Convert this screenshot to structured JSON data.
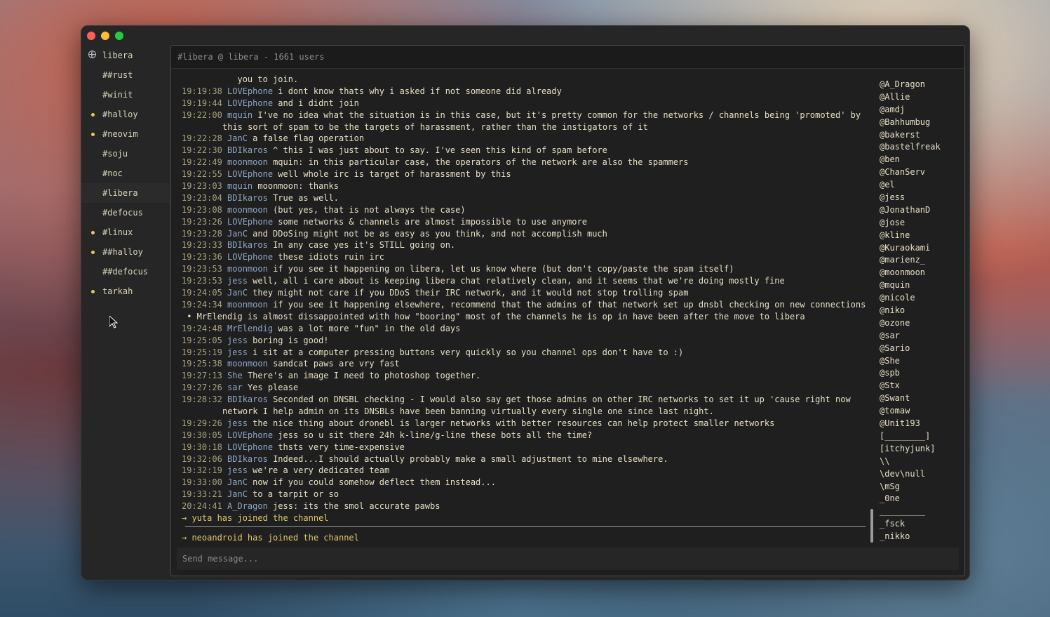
{
  "sidebar": {
    "server": "libera",
    "channels": [
      {
        "name": "##rust",
        "unread": false
      },
      {
        "name": "#winit",
        "unread": false
      },
      {
        "name": "#halloy",
        "unread": true
      },
      {
        "name": "#neovim",
        "unread": true
      },
      {
        "name": "#soju",
        "unread": false
      },
      {
        "name": "#noc",
        "unread": false
      },
      {
        "name": "#libera",
        "unread": false,
        "active": true
      },
      {
        "name": "#defocus",
        "unread": false
      },
      {
        "name": "#linux",
        "unread": true
      },
      {
        "name": "##halloy",
        "unread": true
      },
      {
        "name": "##defocus",
        "unread": false
      },
      {
        "name": "tarkah",
        "unread": true
      }
    ]
  },
  "header": {
    "title": "#libera @ libera - 1661 users"
  },
  "messages": [
    {
      "time": "",
      "nick": "",
      "text": "           you to join."
    },
    {
      "time": "19:19:38",
      "nick": "LOVEphone",
      "text": "i dont know thats why i asked if not someone did already"
    },
    {
      "time": "19:19:44",
      "nick": "LOVEphone",
      "text": "and i didnt join"
    },
    {
      "time": "19:22:00",
      "nick": "mquin",
      "text": "I've no idea what the situation is in this case, but it's pretty common for the networks / channels being 'promoted' by this sort of spam to be the targets of harassment, rather than the instigators of it",
      "tall": true
    },
    {
      "time": "19:22:28",
      "nick": "JanC",
      "text": "a false flag operation"
    },
    {
      "time": "19:22:30",
      "nick": "BDIkaros",
      "text": "^ this I was just about to say. I've seen this kind of spam before"
    },
    {
      "time": "19:22:49",
      "nick": "moonmoon",
      "text": "mquin: in this particular case, the operators of the network are also the spammers"
    },
    {
      "time": "19:22:55",
      "nick": "LOVEphone",
      "text": "well whole irc is target of harassment by this"
    },
    {
      "time": "19:23:03",
      "nick": "mquin",
      "text": "moonmoon: thanks"
    },
    {
      "time": "19:23:04",
      "nick": "BDIkaros",
      "text": "True as well."
    },
    {
      "time": "19:23:08",
      "nick": "moonmoon",
      "text": "(but yes, that is not always the case)"
    },
    {
      "time": "19:23:26",
      "nick": "LOVEphone",
      "text": "some networks & channels are almost impossible to use anymore"
    },
    {
      "time": "19:23:28",
      "nick": "JanC",
      "text": "and DDoSing might not be as easy as you think, and not accomplish much"
    },
    {
      "time": "19:23:33",
      "nick": "BDIkaros",
      "text": "In any case yes it's STILL going on."
    },
    {
      "time": "19:23:36",
      "nick": "LOVEphone",
      "text": "these idiots ruin irc"
    },
    {
      "time": "19:23:53",
      "nick": "moonmoon",
      "text": "if you see it happening on libera, let us know where (but don't copy/paste the spam itself)"
    },
    {
      "time": "19:23:53",
      "nick": "jess",
      "text": "well, all i care about is keeping libera chat relatively clean, and it seems that we're doing mostly fine"
    },
    {
      "time": "19:24:05",
      "nick": "JanC",
      "text": "they might not care if you DDoS their IRC network, and it would not stop trolling spam"
    },
    {
      "time": "19:24:34",
      "nick": "moonmoon",
      "text": "if you see it happening elsewhere, recommend that the admins of that network set up dnsbl checking on new connections"
    },
    {
      "time": "",
      "nick": "",
      "text": " • MrElendig is almost dissappointed with how \"booring\" most of the channels he is op in have been after the move to libera",
      "action": true
    },
    {
      "time": "19:24:48",
      "nick": "MrElendig",
      "text": "was a lot more \"fun\" in the old days"
    },
    {
      "time": "19:25:05",
      "nick": "jess",
      "text": "boring is good!"
    },
    {
      "time": "19:25:19",
      "nick": "jess",
      "text": "i sit at a computer pressing buttons very quickly so you channel ops don't have to :)"
    },
    {
      "time": "19:25:38",
      "nick": "moonmoon",
      "text": "sandcat paws are vry fast"
    },
    {
      "time": "19:27:13",
      "nick": "She",
      "text": "There's an image I need to photoshop together."
    },
    {
      "time": "19:27:26",
      "nick": "sar",
      "text": "Yes please"
    },
    {
      "time": "19:28:32",
      "nick": "BDIkaros",
      "text": "Seconded on DNSBL checking - I would also say get those admins on other IRC networks to set it up 'cause right now network I help admin on its DNSBLs have been banning virtually every single one since last night.",
      "tall": true
    },
    {
      "time": "19:29:26",
      "nick": "jess",
      "text": "the nice thing about dronebl is larger networks with better resources can help protect smaller networks"
    },
    {
      "time": "19:30:05",
      "nick": "LOVEphone",
      "text": "jess so u sit there 24h k-line/g-line these bots all the time?"
    },
    {
      "time": "19:30:18",
      "nick": "LOVEphone",
      "text": "thsts very time-expensive"
    },
    {
      "time": "19:32:06",
      "nick": "BDIkaros",
      "text": "Indeed...I should actually probably make a small adjustment to mine elsewhere."
    },
    {
      "time": "19:32:19",
      "nick": "jess",
      "text": "we're a very dedicated team"
    },
    {
      "time": "19:33:00",
      "nick": "JanC",
      "text": "now if you could somehow deflect them instead..."
    },
    {
      "time": "19:33:21",
      "nick": "JanC",
      "text": "to a tarpit or so"
    },
    {
      "time": "20:24:41",
      "nick": "A_Dragon",
      "text": "jess: its the smol accurate pawbs"
    }
  ],
  "joins": [
    "→ yuta has joined the channel",
    "→ neoandroid has joined the channel"
  ],
  "users": [
    "@A_Dragon",
    "@Allie",
    "@amdj",
    "@Bahhumbug",
    "@bakerst",
    "@bastelfreak",
    "@ben",
    "@ChanServ",
    "@el",
    "@jess",
    "@JonathanD",
    "@jose",
    "@kline",
    "@Kuraokami",
    "@marienz_",
    "@moonmoon",
    "@mquin",
    "@nicole",
    "@niko",
    "@ozone",
    "@sar",
    "@Sario",
    "@She",
    "@spb",
    "@Stx",
    "@Swant",
    "@tomaw",
    "@Unit193",
    "[________]",
    "[itchyjunk]",
    "\\\\",
    "\\dev\\null",
    "\\mSg",
    "_0ne",
    "_________",
    "_fsck",
    "_nikko"
  ],
  "input": {
    "placeholder": "Send message..."
  },
  "colors": {
    "unread_dot": "#e8c85a",
    "timestamp": "#a8a27e",
    "nick": "#8fa6c4",
    "join": "#e2c76a"
  }
}
